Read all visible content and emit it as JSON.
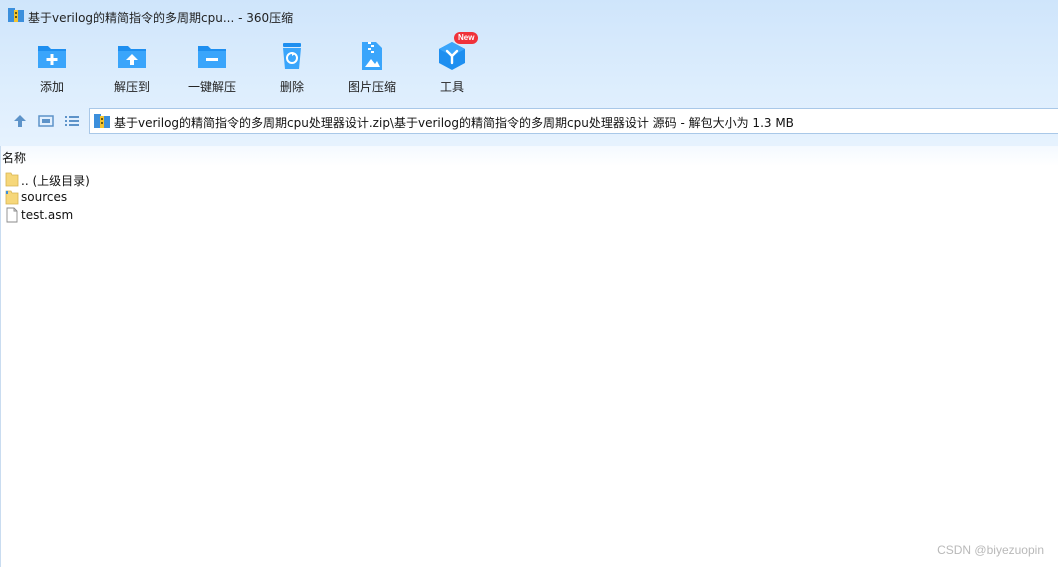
{
  "window": {
    "title": "基于verilog的精简指令的多周期cpu... - 360压缩"
  },
  "toolbar": {
    "items": [
      {
        "label": "添加",
        "icon": "add-folder-icon"
      },
      {
        "label": "解压到",
        "icon": "extract-to-icon"
      },
      {
        "label": "一键解压",
        "icon": "one-click-extract-icon"
      },
      {
        "label": "删除",
        "icon": "recycle-bin-icon"
      },
      {
        "label": "图片压缩",
        "icon": "image-compress-icon"
      },
      {
        "label": "工具",
        "icon": "tools-cube-icon"
      }
    ],
    "badge": "New"
  },
  "address": {
    "path": "基于verilog的精简指令的多周期cpu处理器设计.zip\\基于verilog的精简指令的多周期cpu处理器设计 源码 - 解包大小为 1.3 MB"
  },
  "list": {
    "column_name": "名称",
    "rows": [
      {
        "name": ".. (上级目录)",
        "icon": "folder-icon"
      },
      {
        "name": "sources",
        "icon": "folder-icon"
      },
      {
        "name": "test.asm",
        "icon": "file-icon"
      }
    ]
  },
  "watermark": "CSDN @biyezuopin",
  "colors": {
    "toolbar_bg": "#d6e9fc",
    "icon_blue": "#1e8ff0",
    "badge_red": "#f0323a"
  }
}
